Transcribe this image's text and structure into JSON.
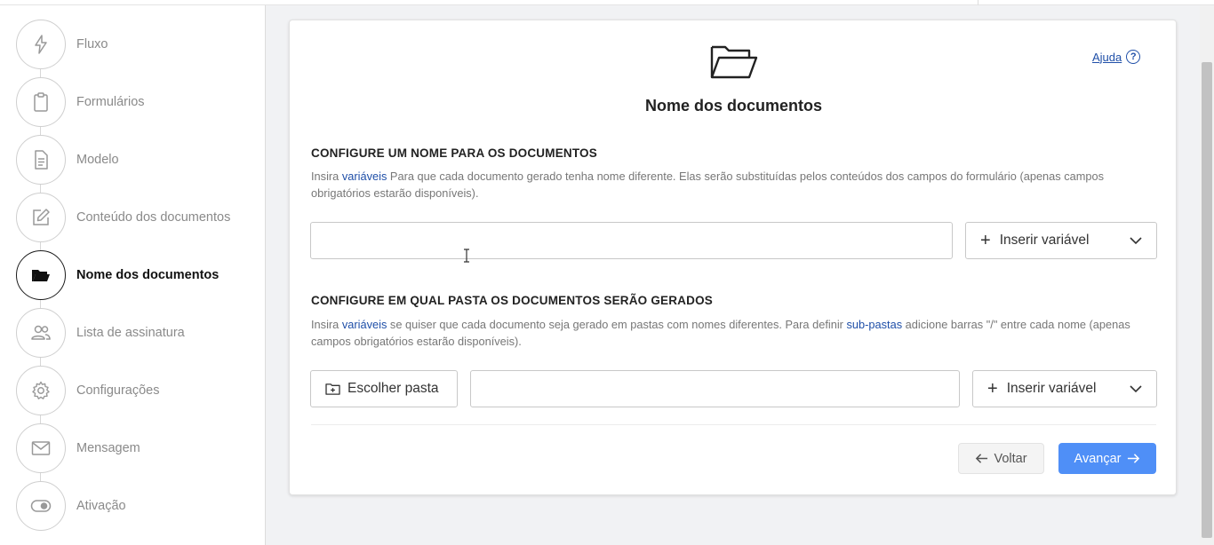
{
  "sidebar": {
    "steps": [
      {
        "label": "Fluxo",
        "icon": "lightning-icon"
      },
      {
        "label": "Formulários",
        "icon": "clipboard-icon"
      },
      {
        "label": "Modelo",
        "icon": "document-icon"
      },
      {
        "label": "Conteúdo dos documentos",
        "icon": "edit-icon"
      },
      {
        "label": "Nome dos documentos",
        "icon": "folder-open-icon",
        "active": true
      },
      {
        "label": "Lista de assinatura",
        "icon": "users-icon"
      },
      {
        "label": "Configurações",
        "icon": "gear-icon"
      },
      {
        "label": "Mensagem",
        "icon": "envelope-icon"
      },
      {
        "label": "Ativação",
        "icon": "toggle-icon"
      }
    ]
  },
  "card": {
    "title": "Nome dos documentos",
    "help_label": "Ajuda",
    "help_icon_glyph": "?",
    "section1": {
      "title": "CONFIGURE UM NOME PARA OS DOCUMENTOS",
      "desc_before": "Insira ",
      "desc_link": "variáveis",
      "desc_after": " Para que cada documento gerado tenha nome diferente. Elas serão substituídas pelos conteúdos dos campos do formulário (apenas campos obrigatórios estarão disponíveis).",
      "input_value": "",
      "insert_variable_label": "Inserir variável"
    },
    "section2": {
      "title": "CONFIGURE EM QUAL PASTA OS DOCUMENTOS SERÃO GERADOS",
      "desc_before": "Insira ",
      "desc_link1": "variáveis",
      "desc_middle": " se quiser que cada documento seja gerado em pastas com nomes diferentes. Para definir ",
      "desc_link2": "sub-pastas",
      "desc_after": " adicione barras \"/\" entre cada nome (apenas campos obrigatórios estarão disponíveis).",
      "choose_folder_label": "Escolher pasta",
      "input_value": "",
      "insert_variable_label": "Inserir variável"
    },
    "back_label": "Voltar",
    "next_label": "Avançar"
  },
  "colors": {
    "accent": "#4f8ff7",
    "link": "#1f4fa8",
    "muted": "#8a8a8a"
  }
}
